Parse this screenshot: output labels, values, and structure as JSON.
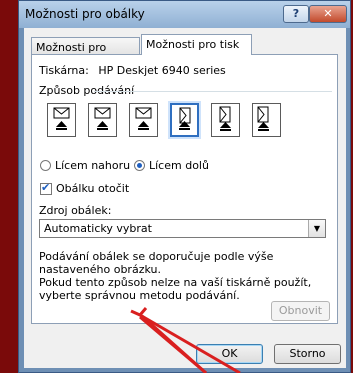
{
  "window": {
    "title": "Možnosti pro obálky",
    "help_label": "?",
    "close_label": "✕"
  },
  "tabs": [
    {
      "label": "Možnosti pro obálky",
      "selected": false
    },
    {
      "label": "Možnosti pro tisk",
      "selected": true
    }
  ],
  "printer": {
    "label": "Tiskárna:",
    "value": "HP Deskjet 6940 series"
  },
  "feed": {
    "group_label": "Způsob podávání",
    "options_count": 6,
    "selected_index": 3
  },
  "orientation": {
    "face_up_label": "Lícem nahoru",
    "face_down_label": "Lícem dolů",
    "selected": "face_down"
  },
  "rotate": {
    "label": "Obálku otočit",
    "checked": true
  },
  "source": {
    "label": "Zdroj obálek:",
    "value": "Automaticky vybrat"
  },
  "note": {
    "line1": "Podávání obálek se doporučuje podle výše nastaveného obrázku.",
    "line2": "Pokud tento způsob nelze na vaší tiskárně použít, vyberte správnou metodu podávání."
  },
  "buttons": {
    "reset": "Obnovit",
    "ok": "OK",
    "cancel": "Storno"
  },
  "colors": {
    "accent": "#2f6fc0",
    "annotation_arrow": "#d91f1f",
    "backdrop": "#7a0a0a"
  }
}
